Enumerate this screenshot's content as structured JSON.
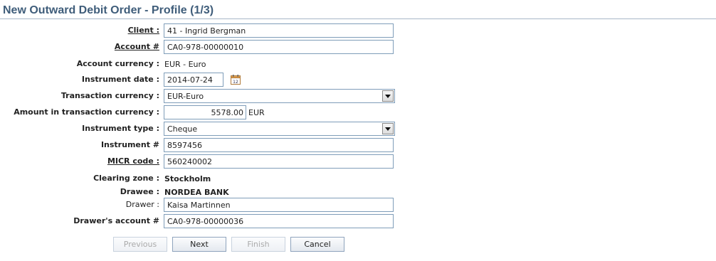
{
  "page": {
    "title": "New Outward Debit Order - Profile (1/3)"
  },
  "form": {
    "client": {
      "label": "Client :",
      "value": "41 - Ingrid  Bergman"
    },
    "account": {
      "label": "Account #",
      "value": "CA0-978-00000010"
    },
    "account_currency": {
      "label": "Account currency :",
      "value": "EUR - Euro"
    },
    "instrument_date": {
      "label": "Instrument date :",
      "value": "2014-07-24",
      "calendar_icon": "calendar-icon"
    },
    "transaction_currency": {
      "label": "Transaction currency :",
      "value": "EUR-Euro"
    },
    "amount": {
      "label": "Amount in transaction currency :",
      "value": "5578.00",
      "unit": "EUR"
    },
    "instrument_type": {
      "label": "Instrument type :",
      "value": "Cheque"
    },
    "instrument_no": {
      "label": "Instrument #",
      "value": "8597456"
    },
    "micr_code": {
      "label": "MICR code :",
      "value": "560240002"
    },
    "clearing_zone": {
      "label": "Clearing zone :",
      "value": "Stockholm"
    },
    "drawee": {
      "label": "Drawee :",
      "value": "NORDEA BANK"
    },
    "drawer": {
      "label": "Drawer :",
      "value": "Kaisa Martinnen"
    },
    "drawer_account": {
      "label": "Drawer's account #",
      "value": "CA0-978-00000036"
    }
  },
  "buttons": {
    "previous": "Previous",
    "next": "Next",
    "finish": "Finish",
    "cancel": "Cancel"
  }
}
